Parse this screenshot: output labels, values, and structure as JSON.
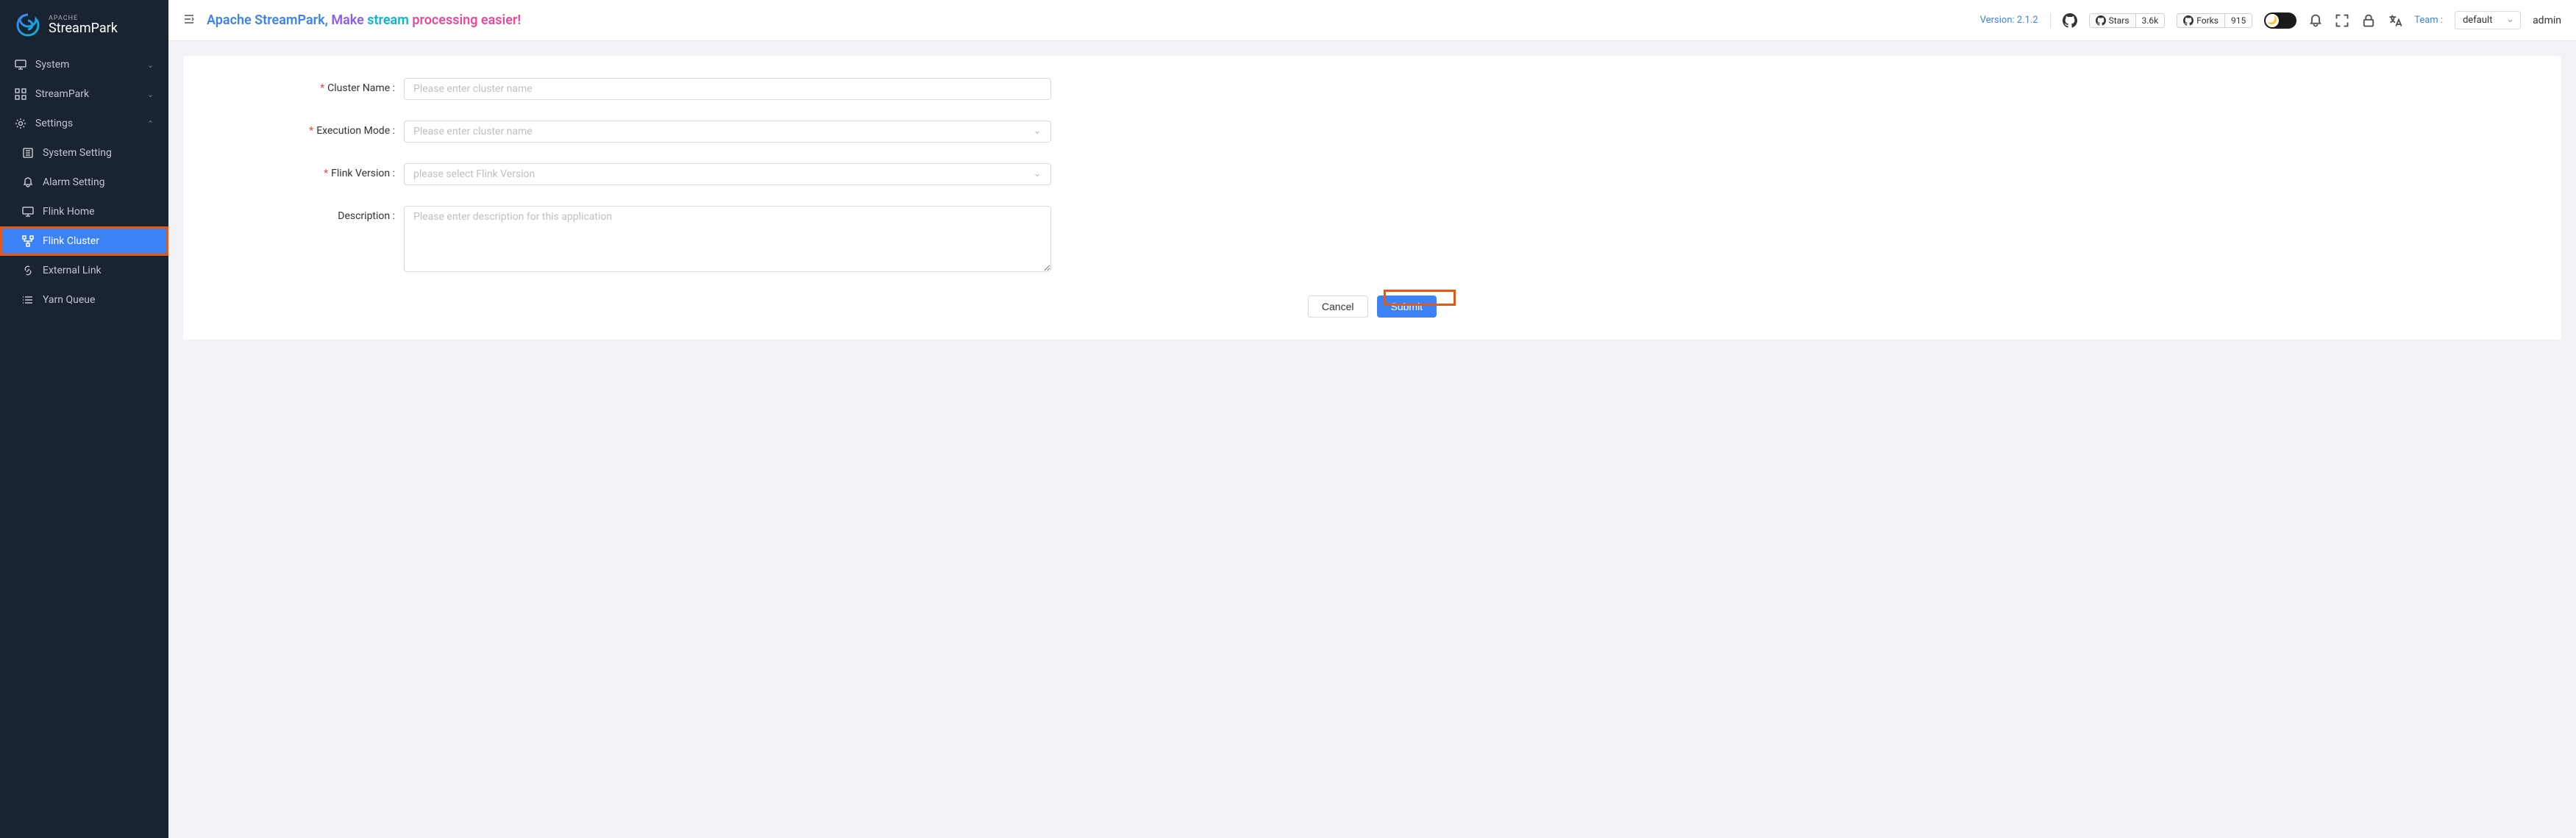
{
  "logo": {
    "top": "APACHE",
    "main": "StreamPark"
  },
  "sidebar": {
    "system": {
      "label": "System"
    },
    "streampark": {
      "label": "StreamPark"
    },
    "settings": {
      "label": "Settings"
    },
    "systemSetting": {
      "label": "System Setting"
    },
    "alarmSetting": {
      "label": "Alarm Setting"
    },
    "flinkHome": {
      "label": "Flink Home"
    },
    "flinkCluster": {
      "label": "Flink Cluster"
    },
    "externalLink": {
      "label": "External Link"
    },
    "yarnQueue": {
      "label": "Yarn Queue"
    }
  },
  "header": {
    "tagline_part1": "Apache StreamPark,",
    "tagline_part2": "Make",
    "tagline_part3": "stream",
    "tagline_part4": "processing easier!",
    "version": "Version: 2.1.2",
    "stars_label": "Stars",
    "stars_count": "3.6k",
    "forks_label": "Forks",
    "forks_count": "915",
    "team_label": "Team :",
    "team_value": "default",
    "user": "admin"
  },
  "form": {
    "clusterName": {
      "label": "Cluster Name :",
      "placeholder": "Please enter cluster name"
    },
    "executionMode": {
      "label": "Execution Mode :",
      "placeholder": "Please enter cluster name"
    },
    "flinkVersion": {
      "label": "Flink Version :",
      "placeholder": "please select Flink Version"
    },
    "description": {
      "label": "Description :",
      "placeholder": "Please enter description for this application"
    },
    "cancel": "Cancel",
    "submit": "Submit"
  }
}
